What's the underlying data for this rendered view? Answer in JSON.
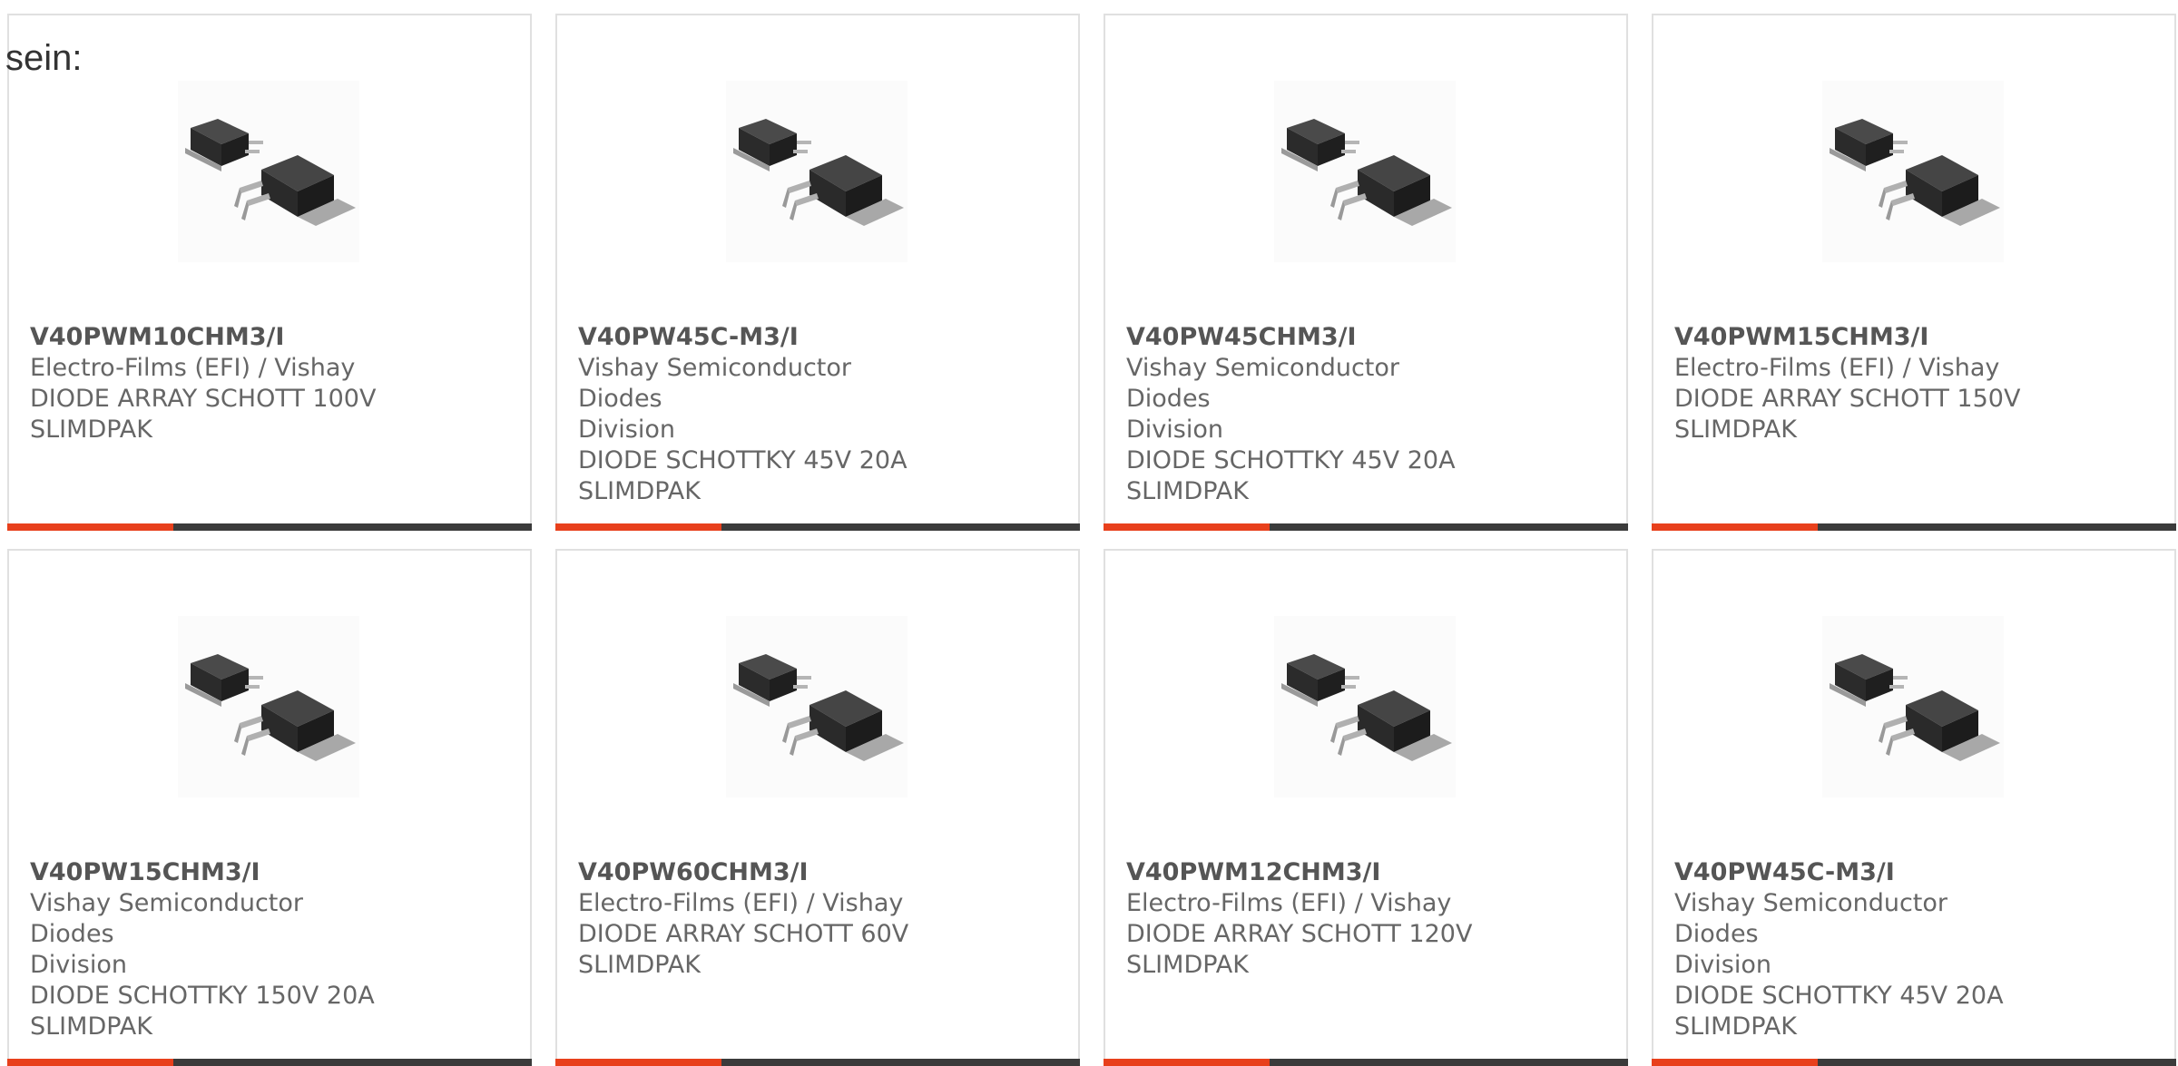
{
  "intro_text": "sein:",
  "colors": {
    "accent": "#e8401c",
    "bar": "#3b3b3b",
    "border": "#e0e0e0",
    "text": "#666666"
  },
  "products": [
    {
      "part_number": "V40PWM10CHM3/I",
      "manufacturer_lines": [
        "Electro-Films (EFI) / Vishay"
      ],
      "description_lines": [
        "DIODE ARRAY SCHOTT 100V",
        "SLIMDPAK"
      ],
      "image_icon": "component-package-icon"
    },
    {
      "part_number": "V40PW45C-M3/I",
      "manufacturer_lines": [
        "Vishay Semiconductor Diodes",
        "Division"
      ],
      "description_lines": [
        "DIODE SCHOTTKY 45V 20A",
        "SLIMDPAK"
      ],
      "image_icon": "component-package-icon"
    },
    {
      "part_number": "V40PW45CHM3/I",
      "manufacturer_lines": [
        "Vishay Semiconductor Diodes",
        "Division"
      ],
      "description_lines": [
        "DIODE SCHOTTKY 45V 20A",
        "SLIMDPAK"
      ],
      "image_icon": "component-package-icon"
    },
    {
      "part_number": "V40PWM15CHM3/I",
      "manufacturer_lines": [
        "Electro-Films (EFI) / Vishay"
      ],
      "description_lines": [
        "DIODE ARRAY SCHOTT 150V",
        "SLIMDPAK"
      ],
      "image_icon": "component-package-icon"
    },
    {
      "part_number": "V40PW15CHM3/I",
      "manufacturer_lines": [
        "Vishay Semiconductor Diodes",
        "Division"
      ],
      "description_lines": [
        "DIODE SCHOTTKY 150V 20A",
        "SLIMDPAK"
      ],
      "image_icon": "component-package-icon"
    },
    {
      "part_number": "V40PW60CHM3/I",
      "manufacturer_lines": [
        "Electro-Films (EFI) / Vishay"
      ],
      "description_lines": [
        "DIODE ARRAY SCHOTT 60V",
        "SLIMDPAK"
      ],
      "image_icon": "component-package-icon"
    },
    {
      "part_number": "V40PWM12CHM3/I",
      "manufacturer_lines": [
        "Electro-Films (EFI) / Vishay"
      ],
      "description_lines": [
        "DIODE ARRAY SCHOTT 120V",
        "SLIMDPAK"
      ],
      "image_icon": "component-package-icon"
    },
    {
      "part_number": "V40PW45C-M3/I",
      "manufacturer_lines": [
        "Vishay Semiconductor Diodes",
        "Division"
      ],
      "description_lines": [
        "DIODE SCHOTTKY 45V 20A",
        "SLIMDPAK"
      ],
      "image_icon": "component-package-icon"
    }
  ]
}
